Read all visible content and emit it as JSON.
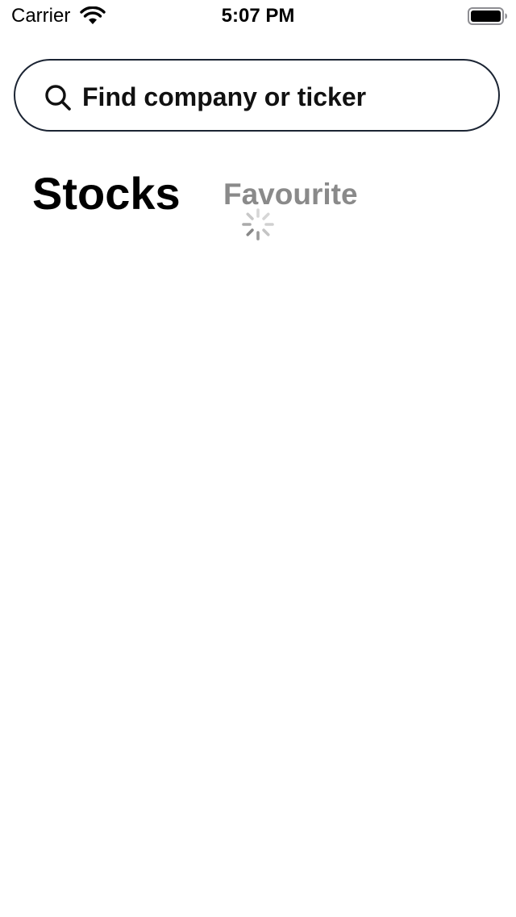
{
  "status_bar": {
    "carrier": "Carrier",
    "time": "5:07 PM",
    "wifi_icon": "wifi-icon",
    "battery_icon": "battery-full-icon"
  },
  "search": {
    "placeholder": "Find company or ticker",
    "icon": "search-icon"
  },
  "tabs": [
    {
      "label": "Stocks",
      "active": true
    },
    {
      "label": "Favourite",
      "active": false
    }
  ],
  "loading": {
    "icon": "loading-spinner-icon"
  },
  "colors": {
    "search_border": "#1b2433",
    "tab_active": "#000000",
    "tab_inactive": "#8a8a8a",
    "spinner": "#9a9a9a"
  }
}
